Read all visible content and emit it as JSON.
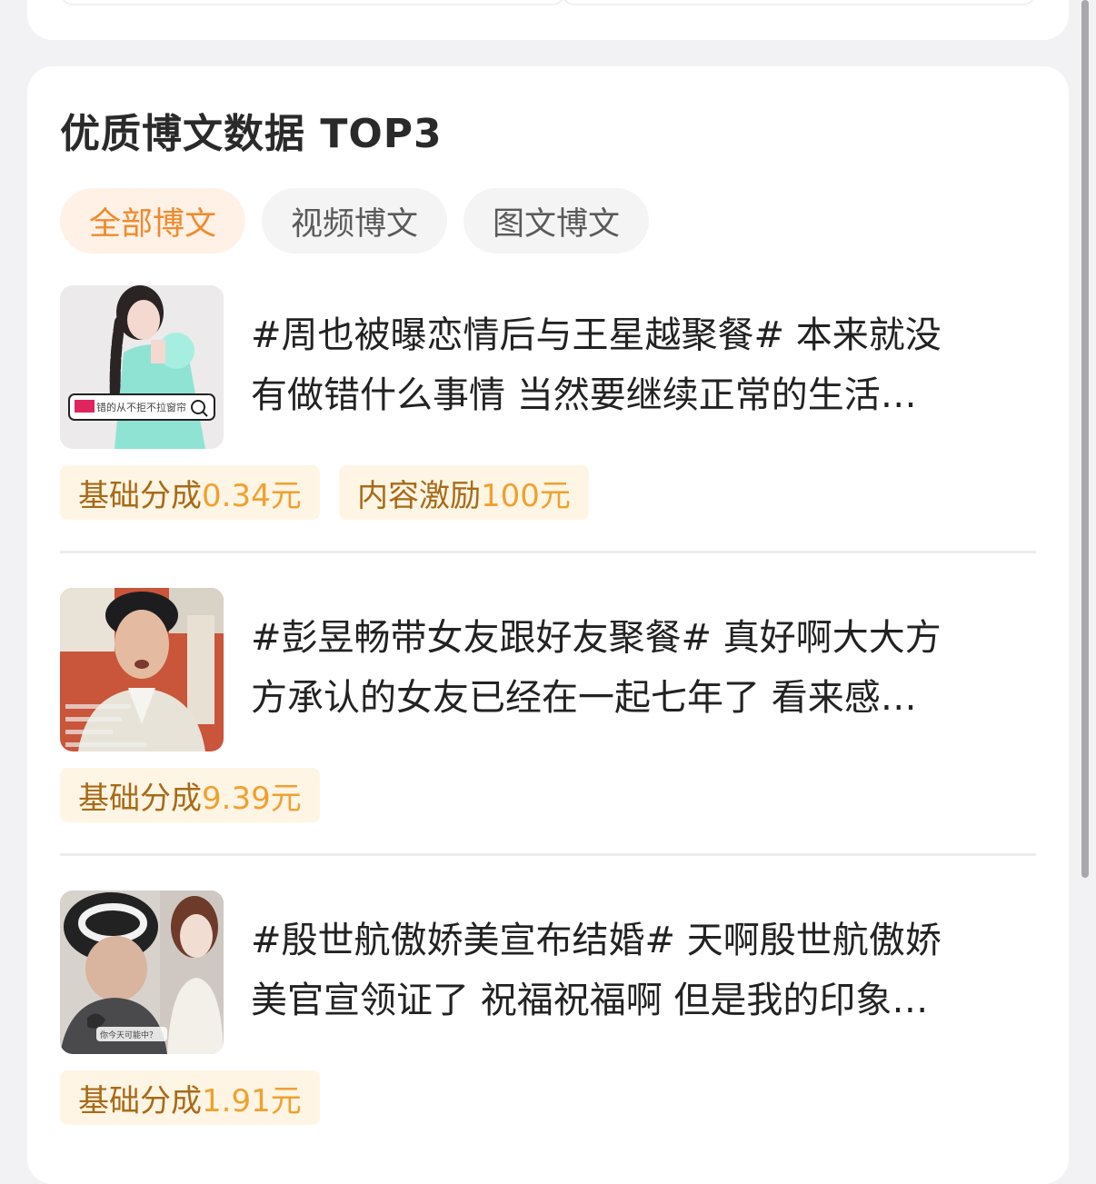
{
  "section_title": "优质博文数据 TOP3",
  "tabs": [
    {
      "label": "全部博文",
      "active": true
    },
    {
      "label": "视频博文",
      "active": false
    },
    {
      "label": "图文博文",
      "active": false
    }
  ],
  "posts": [
    {
      "text": "#周也被曝恋情后与王星越聚餐# 本来就没\n有做错什么事情 当然要继续正常的生活…",
      "thumb_icon": "woman-in-mint-dress-photo",
      "thumb_caption": "错的从不拒不拉窗帘",
      "tags": [
        {
          "label": "基础分成",
          "amount": "0.34元"
        },
        {
          "label": "内容激励",
          "amount": "100元"
        }
      ]
    },
    {
      "text": "#彭昱畅带女友跟好友聚餐# 真好啊大大方\n方承认的女友已经在一起七年了 看来感…",
      "thumb_icon": "man-talking-livestream-photo",
      "tags": [
        {
          "label": "基础分成",
          "amount": "9.39元"
        }
      ]
    },
    {
      "text": "#殷世航傲娇美宣布结婚# 天啊殷世航傲娇\n美官宣领证了 祝福祝福啊 但是我的印象…",
      "thumb_icon": "couple-livestream-photo",
      "thumb_caption": "你今天可能中？",
      "tags": [
        {
          "label": "基础分成",
          "amount": "1.91元"
        }
      ]
    }
  ],
  "colors": {
    "accent_orange": "#f08a2c",
    "tag_background": "#fff5e4",
    "tab_active_background": "#fff1e6"
  }
}
